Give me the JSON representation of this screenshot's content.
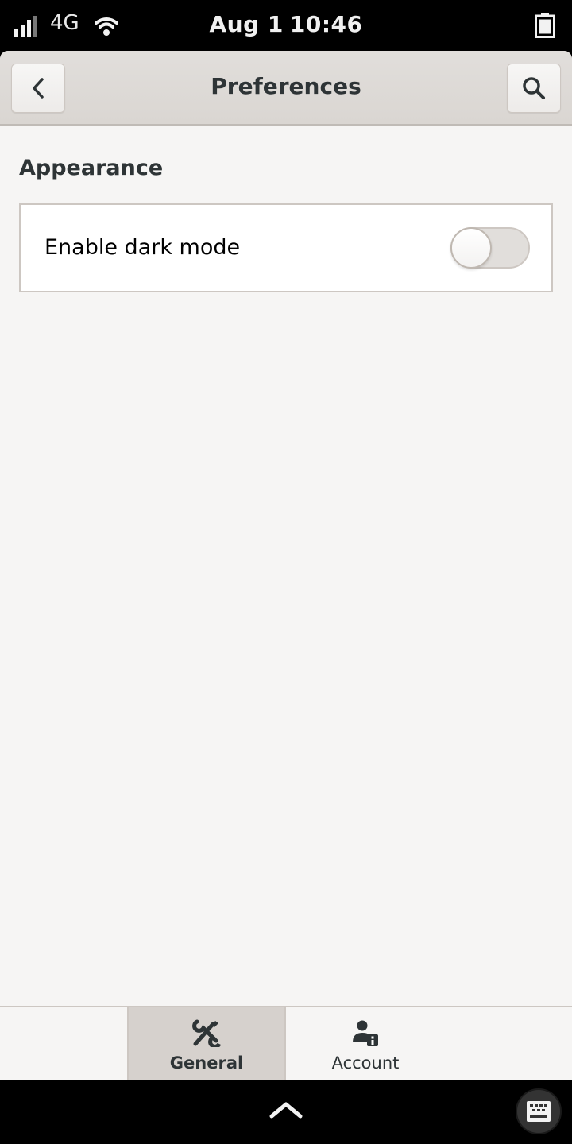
{
  "status_bar": {
    "network_type": "4G",
    "date": "Aug 1",
    "time": "10:46",
    "icons": [
      "signal-icon",
      "wifi-icon",
      "battery-icon"
    ]
  },
  "header": {
    "title": "Preferences",
    "back_icon": "chevron-left-icon",
    "search_icon": "search-icon"
  },
  "sections": [
    {
      "title": "Appearance",
      "rows": [
        {
          "label": "Enable dark mode",
          "control": "switch",
          "enabled": false
        }
      ]
    }
  ],
  "view_switcher": {
    "tabs": [
      {
        "label": "General",
        "icon": "tools-icon",
        "active": true
      },
      {
        "label": "Account",
        "icon": "user-info-icon",
        "active": false
      }
    ]
  },
  "nav_bar": {
    "icons": [
      "chevron-up-icon",
      "keyboard-icon"
    ]
  },
  "colors": {
    "headerbar": "#dad6d2",
    "window_bg": "#f6f5f4",
    "text": "#2e3436",
    "border": "#cdc7c2",
    "active_tab": "#d6d1cd"
  }
}
